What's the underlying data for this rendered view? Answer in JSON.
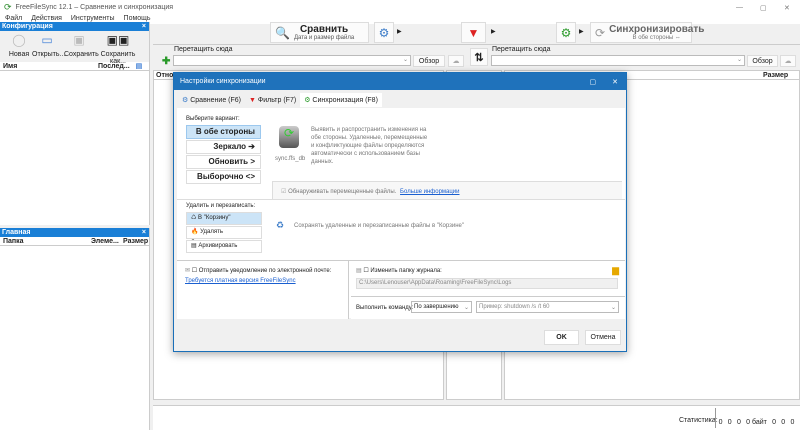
{
  "window": {
    "title": "FreeFileSync 12.1 – Сравнение и синхронизация",
    "min": "—",
    "max": "▢",
    "close": "✕"
  },
  "menu": [
    "Файл",
    "Действия",
    "Инструменты",
    "Помощь"
  ],
  "config_panel": {
    "title": "Конфигурация",
    "close": "×",
    "buttons": [
      "Новая",
      "Открыть...",
      "Сохранить",
      "Сохранить как..."
    ],
    "columns": [
      "Имя",
      "Послед..."
    ]
  },
  "main_panel": {
    "title": "Главная",
    "close": "×",
    "columns": [
      "Папка",
      "Элеме...",
      "Размер"
    ]
  },
  "toolbar": {
    "compare_label": "Сравнить",
    "compare_sub": "Дата и размер файла",
    "sync_label": "Синхронизировать",
    "sync_sub": "В обе стороны ⇔"
  },
  "folders": {
    "left_label": "Перетащить сюда",
    "right_label": "Перетащить сюда",
    "browse": "Обзор"
  },
  "grid": {
    "left_col": "Относ",
    "right_col": "Размер"
  },
  "dialog": {
    "title": "Настройки синхронизации",
    "tabs": [
      "Сравнение (F6)",
      "Фильтр (F7)",
      "Синхронизация (F8)"
    ],
    "choose_label": "Выберите вариант:",
    "variants": [
      "В обе стороны ⇔",
      "Зеркало ➔",
      "Обновить >",
      "Выборочно <>"
    ],
    "db_caption": "sync.ffs_db",
    "description": "Выявить и распространить изменения на обе стороны. Удаленные, перемещенные и конфликтующие файлы определяются автоматически с использованием базы данных.",
    "detect_moved": "Обнаруживать перемещенные файлы.",
    "more_info": "Больше информации",
    "delete_label": "Удалить и перезаписать:",
    "delete_options": [
      "В \"Корзину\"",
      "Удалять безвозвратно",
      "Архивировать"
    ],
    "delete_desc": "Сохранять удаленные и перезаписанные файлы в \"Корзине\"",
    "email_label": "Отправить уведомление по электронной почте:",
    "paid_link": "Требуется платная версия FreeFileSync",
    "log_label": "Изменить папку журнала:",
    "log_path": "C:\\Users\\Lenouser\\AppData\\Roaming\\FreeFileSync\\Logs",
    "run_cmd_label": "Выполнить команду:",
    "run_when": "По завершению",
    "cmd_placeholder": "Пример: shutdown /s /t 60",
    "ok": "OK",
    "cancel": "Отмена"
  },
  "stats": {
    "label": "Статистика:",
    "values": [
      "0",
      "0",
      "0",
      "0 байт",
      "0",
      "0",
      "0"
    ]
  }
}
